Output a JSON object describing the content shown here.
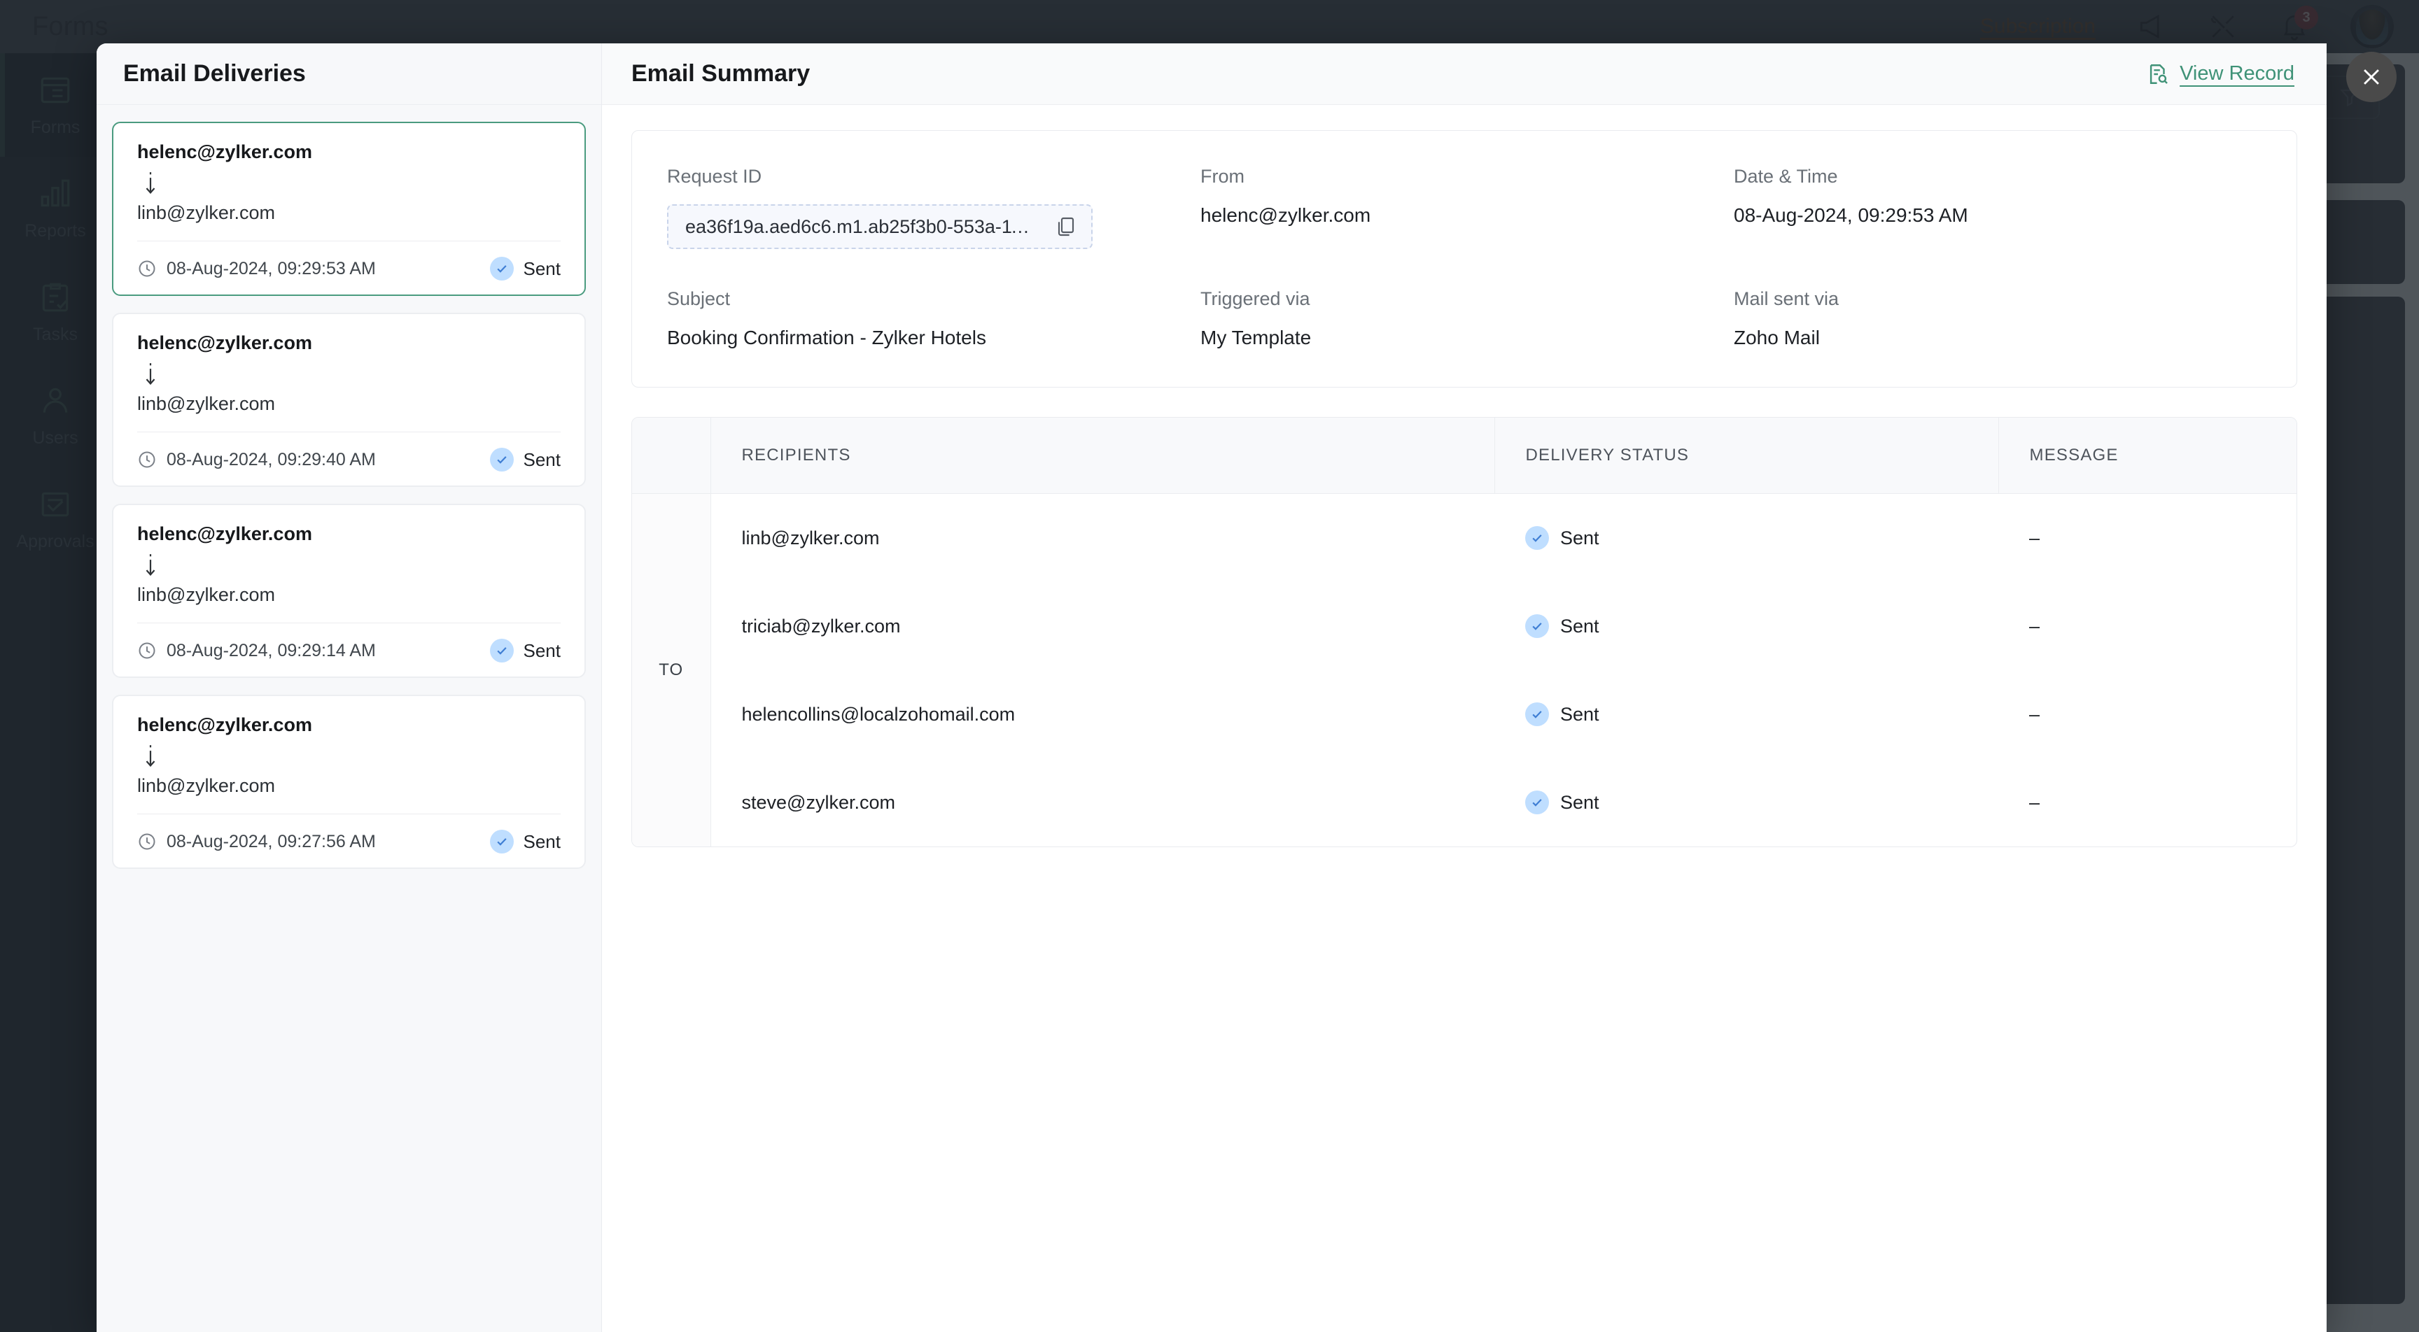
{
  "app": {
    "brand_name": "Forms",
    "subscription_label": "Subscription",
    "notification_count": "3",
    "icons": {
      "brand": "forms-logo-icon",
      "announcement": "megaphone-icon",
      "setup": "tools-icon",
      "notifications": "bell-icon",
      "avatar": "user-avatar"
    },
    "sidebar": {
      "items": [
        {
          "label": "Forms",
          "icon": "form-list-icon",
          "active": true
        },
        {
          "label": "Reports",
          "icon": "bar-chart-icon",
          "active": false
        },
        {
          "label": "Tasks",
          "icon": "clipboard-check-icon",
          "active": false
        },
        {
          "label": "Users",
          "icon": "user-icon",
          "active": false
        },
        {
          "label": "Approvals",
          "icon": "approval-check-icon",
          "active": false
        }
      ]
    }
  },
  "modal": {
    "close_label": "Close",
    "deliveries": {
      "title": "Email Deliveries",
      "cards": [
        {
          "from": "helenc@zylker.com",
          "to": "linb@zylker.com",
          "time": "08-Aug-2024, 09:29:53 AM",
          "status": "Sent",
          "selected": true
        },
        {
          "from": "helenc@zylker.com",
          "to": "linb@zylker.com",
          "time": "08-Aug-2024, 09:29:40 AM",
          "status": "Sent",
          "selected": false
        },
        {
          "from": "helenc@zylker.com",
          "to": "linb@zylker.com",
          "time": "08-Aug-2024, 09:29:14 AM",
          "status": "Sent",
          "selected": false
        },
        {
          "from": "helenc@zylker.com",
          "to": "linb@zylker.com",
          "time": "08-Aug-2024, 09:27:56 AM",
          "status": "Sent",
          "selected": false
        }
      ]
    },
    "summary": {
      "title": "Email Summary",
      "view_record_label": "View Record",
      "fields": [
        {
          "label": "Request ID",
          "value": "ea36f19a.aed6c6.m1.ab25f3b0-553a-11...",
          "type": "copyable"
        },
        {
          "label": "From",
          "value": "helenc@zylker.com",
          "type": "text"
        },
        {
          "label": "Date & Time",
          "value": "08-Aug-2024, 09:29:53 AM",
          "type": "text"
        },
        {
          "label": "Subject",
          "value": "Booking Confirmation - Zylker Hotels",
          "type": "text"
        },
        {
          "label": "Triggered via",
          "value": "My Template",
          "type": "text"
        },
        {
          "label": "Mail sent via",
          "value": "Zoho Mail",
          "type": "text"
        }
      ],
      "recipients_table": {
        "columns": [
          "",
          "RECIPIENTS",
          "DELIVERY STATUS",
          "MESSAGE"
        ],
        "group_label": "TO",
        "rows": [
          {
            "recipient": "linb@zylker.com",
            "status": "Sent",
            "message": "–"
          },
          {
            "recipient": "triciab@zylker.com",
            "status": "Sent",
            "message": "–"
          },
          {
            "recipient": "helencollins@localzohomail.com",
            "status": "Sent",
            "message": "–"
          },
          {
            "recipient": "steve@zylker.com",
            "status": "Sent",
            "message": "–"
          }
        ]
      }
    }
  },
  "colors": {
    "accent_green": "#3f9277",
    "selected_border": "#4a9b7f",
    "status_blue": "#3f7ed4",
    "status_blue_bg": "#bfdeff",
    "topbar": "#434a54",
    "sidebar": "#1e262e",
    "subscription_link": "#6e4a2c"
  }
}
